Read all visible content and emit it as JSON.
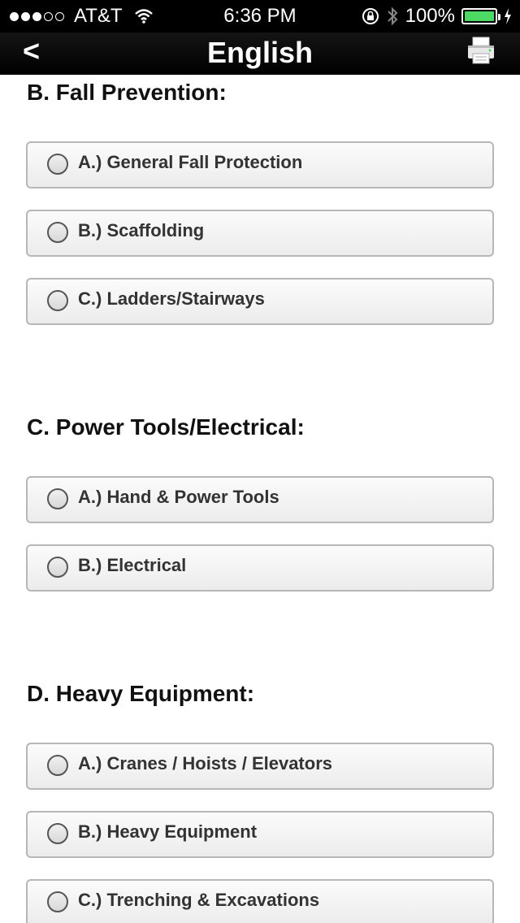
{
  "status_bar": {
    "carrier": "AT&T",
    "signal_strength": 3,
    "signal_max": 5,
    "time": "6:36 PM",
    "battery": "100%",
    "icons": [
      "wifi-icon",
      "rotation-lock-icon",
      "bluetooth-icon",
      "battery-icon",
      "charging-icon"
    ]
  },
  "nav": {
    "back_label": "<",
    "title": "English",
    "right_icon": "printer-icon"
  },
  "sections": [
    {
      "title": "B. Fall Prevention:",
      "options": [
        {
          "label": "A.) General Fall Protection",
          "checked": false
        },
        {
          "label": "B.) Scaffolding",
          "checked": false
        },
        {
          "label": "C.) Ladders/Stairways",
          "checked": false
        }
      ]
    },
    {
      "title": "C. Power Tools/Electrical:",
      "options": [
        {
          "label": "A.) Hand & Power Tools",
          "checked": false
        },
        {
          "label": "B.) Electrical",
          "checked": false
        }
      ]
    },
    {
      "title": "D. Heavy Equipment:",
      "options": [
        {
          "label": "A.) Cranes / Hoists / Elevators",
          "checked": false
        },
        {
          "label": "B.) Heavy Equipment",
          "checked": false
        },
        {
          "label": "C.) Trenching & Excavations",
          "checked": false
        }
      ]
    }
  ]
}
